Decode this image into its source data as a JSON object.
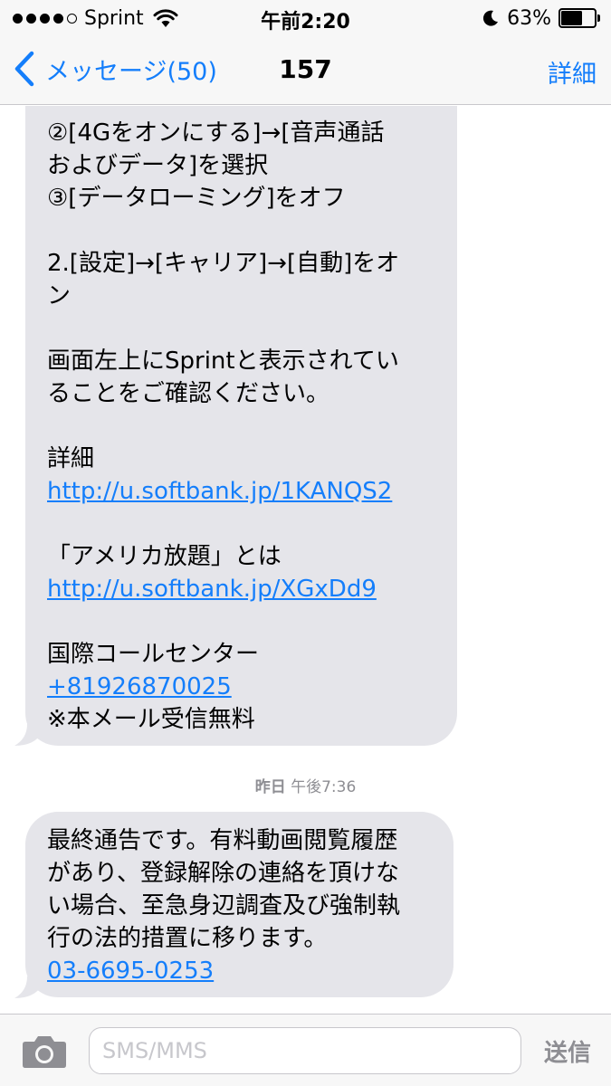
{
  "status_bar": {
    "carrier": "Sprint",
    "time": "午前2:20",
    "battery_percent_label": "63%",
    "battery_level": 0.63,
    "signal_bars_filled": 4,
    "signal_bars_total": 5
  },
  "nav": {
    "back_label": "メッセージ(50)",
    "title": "157",
    "detail_label": "詳細"
  },
  "messages": [
    {
      "lines": [
        "②[4Gをオンにする]→[音声通話",
        "およびデータ]を選択",
        " ③[データローミング]をオフ",
        "",
        "2.[設定]→[キャリア]→[自動]をオ",
        "ン",
        "",
        "画面左上にSprintと表示されてい",
        "ることをご確認ください。",
        "",
        "詳細",
        "http://u.softbank.jp/1KANQS2",
        "",
        "「アメリカ放題」とは",
        "http://u.softbank.jp/XGxDd9",
        "",
        "国際コールセンター",
        "+81926870025",
        "※本メール受信無料"
      ]
    },
    {
      "lines": [
        "最終通告です。有料動画閲覧履歴",
        "があり、登録解除の連絡を頂けな",
        "い場合、至急身辺調査及び強制執",
        "行の法的措置に移ります。",
        "03-6695-0253"
      ]
    }
  ],
  "timestamp": {
    "day": "昨日",
    "time": "午後7:36"
  },
  "input": {
    "placeholder": "SMS/MMS",
    "send_label": "送信"
  },
  "colors": {
    "accent": "#147efb",
    "bubble": "#e5e5ea",
    "bar_background": "#f7f7f7",
    "muted": "#8e8e93"
  }
}
